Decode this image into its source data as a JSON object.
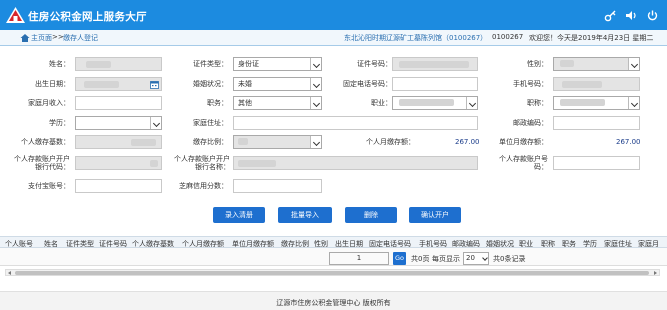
{
  "header": {
    "app_title": "住房公积金网上服务大厅",
    "brand_color": "#1c8be0",
    "icons": [
      "key-icon",
      "speaker-icon",
      "power-icon"
    ]
  },
  "breadcrumb": {
    "home": "主页面",
    "separator": ">>",
    "current": "缴存人登记"
  },
  "status": {
    "unit_name": "东北沁阳时期辽源矿工墓陈列馆（0100267）",
    "account": "0100267",
    "welcome": "欢迎您！今天是2019年4月23日 星期二"
  },
  "form": {
    "name_label": "姓名：",
    "id_type_label": "证件类型：",
    "id_type_value": "身份证",
    "id_number_label": "证件号码：",
    "gender_label": "性别：",
    "birth_label": "出生日期：",
    "marital_label": "婚姻状况：",
    "marital_value": "未婚",
    "phone_label": "固定电话号码：",
    "mobile_label": "手机号码：",
    "income_label": "家庭月收入：",
    "position_label": "职务：",
    "position_value": "其他",
    "occupation_label": "职业：",
    "title_label": "职称：",
    "education_label": "学历：",
    "address_label": "家庭住址：",
    "postcode_label": "邮政编码：",
    "base_label": "个人缴存基数：",
    "ratio_label": "缴存比例：",
    "personal_amount_label": "个人月缴存额：",
    "personal_amount_value": "267.00",
    "unit_amount_label": "单位月缴存额：",
    "unit_amount_value": "267.00",
    "bank_code_label_1": "个人存款账户开户",
    "bank_code_label_2": "银行代码：",
    "bank_name_label_1": "个人存款账户开户",
    "bank_name_label_2": "银行名称：",
    "bank_account_label_1": "个人存款账户号",
    "bank_account_label_2": "码：",
    "alipay_label": "支付宝账号：",
    "sesame_label": "芝麻信用分数："
  },
  "actions": {
    "entry_clear": "录入清册",
    "batch_import": "批量导入",
    "delete": "删除",
    "confirm_open": "确认开户"
  },
  "table": {
    "columns": [
      "个人账号",
      "姓名",
      "证件类型",
      "证件号码",
      "个人缴存基数",
      "个人月缴存额",
      "单位月缴存额",
      "缴存比例",
      "性别",
      "出生日期",
      "固定电话号码",
      "手机号码",
      "邮政编码",
      "婚姻状况",
      "职业",
      "职称",
      "职务",
      "学历",
      "家庭住址",
      "家庭月"
    ]
  },
  "pager": {
    "page": "1",
    "go": "Go",
    "total_pages": "共0页",
    "per_page_label": "每页显示",
    "per_page": "20",
    "total_records": "共0条记录"
  },
  "footer": {
    "text": "辽源市住房公积金管理中心 版权所有"
  }
}
